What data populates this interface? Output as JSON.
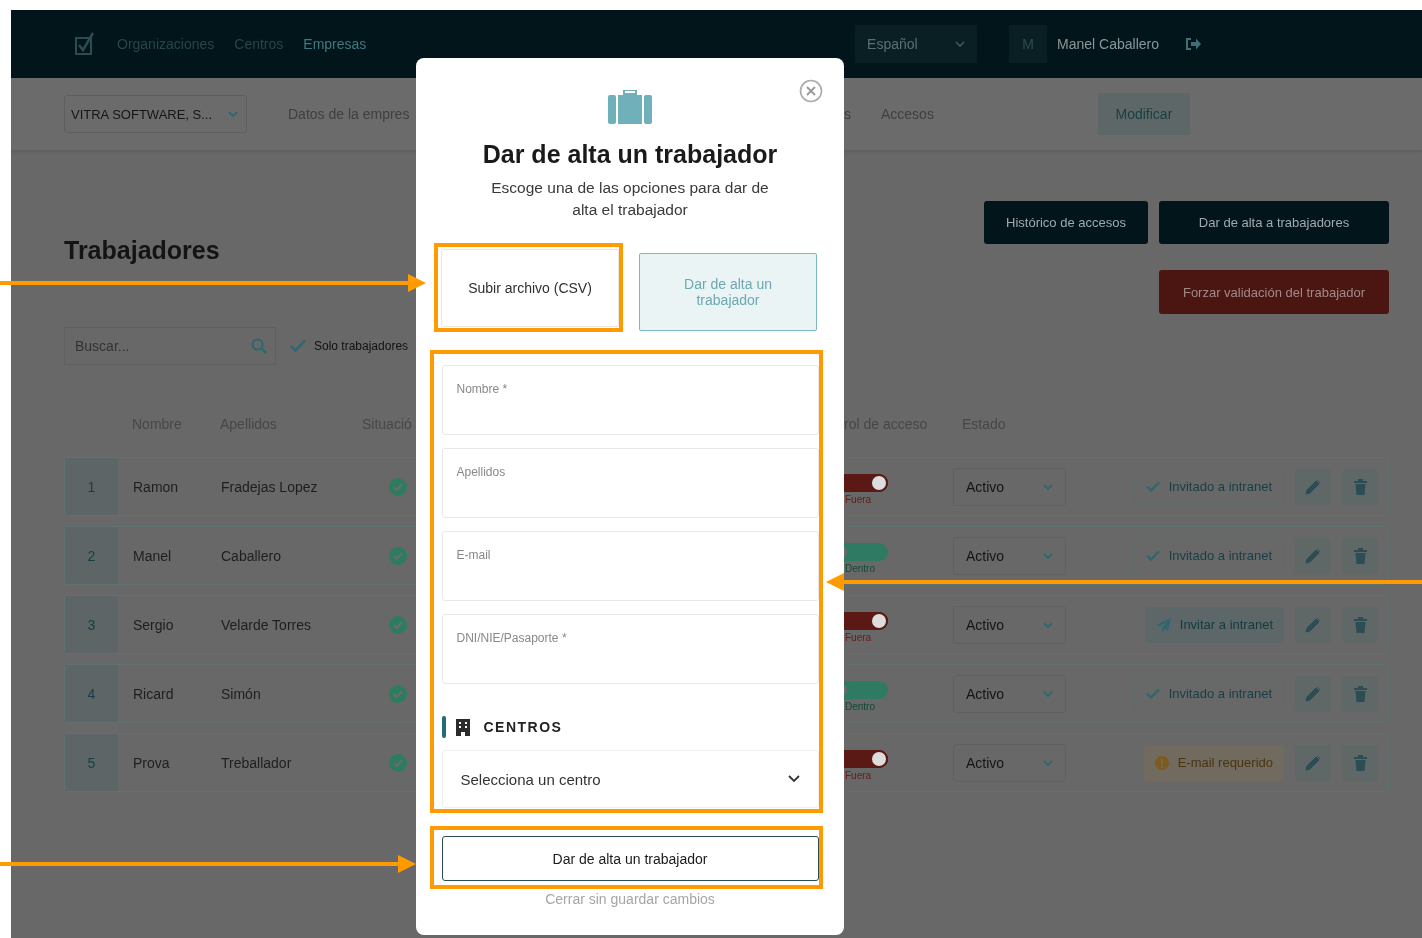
{
  "nav": {
    "links": [
      {
        "label": "Organizaciones",
        "selected": false
      },
      {
        "label": "Centros",
        "selected": false
      },
      {
        "label": "Empresas",
        "selected": true
      }
    ],
    "language": "Español",
    "avatar": "M",
    "user": "Manel Caballero"
  },
  "subheader": {
    "company": "VITRA SOFTWARE, S...",
    "tabs_left": [
      "Datos de la empres"
    ],
    "tabs_right": [
      "s",
      "Accesos"
    ],
    "modify_button": "Modificar"
  },
  "page": {
    "title": "Trabajadores",
    "buttons": [
      "Histórico de accesos",
      "Dar de alta a trabajadores"
    ],
    "force_button": "Forzar validación del trabajador",
    "search": {
      "placeholder": "Buscar..."
    },
    "filter": {
      "label": "Solo trabajadores",
      "checked": true
    }
  },
  "table": {
    "columns_left": [
      "Nombre",
      "Apellidos",
      "Situació"
    ],
    "columns_right": [
      "rol de acceso",
      "Estado"
    ],
    "rows": [
      {
        "number": "1",
        "name": "Ramon",
        "surname": "Fradejas Lopez",
        "verified": true,
        "access_on": false,
        "access_label": "Fuera",
        "status": "Activo",
        "invite": {
          "kind": "invited",
          "label": "Invitado a intranet"
        }
      },
      {
        "number": "2",
        "name": "Manel",
        "surname": "Caballero",
        "verified": true,
        "access_on": true,
        "access_label": "Dentro",
        "status": "Activo",
        "invite": {
          "kind": "invited",
          "label": "Invitado a intranet"
        }
      },
      {
        "number": "3",
        "name": "Sergio",
        "surname": "Velarde Torres",
        "verified": true,
        "access_on": false,
        "access_label": "Fuera",
        "status": "Activo",
        "invite": {
          "kind": "invite",
          "label": "Invitar a intranet"
        }
      },
      {
        "number": "4",
        "name": "Ricard",
        "surname": "Simón",
        "verified": true,
        "access_on": true,
        "access_label": "Dentro",
        "status": "Activo",
        "invite": {
          "kind": "invited",
          "label": "Invitado a intranet"
        }
      },
      {
        "number": "5",
        "name": "Prova",
        "surname": "Treballador",
        "verified": true,
        "access_on": false,
        "access_label": "Fuera",
        "status": "Activo",
        "invite": {
          "kind": "email_required",
          "label": "E-mail requerido"
        }
      }
    ]
  },
  "modal": {
    "title": "Dar de alta un trabajador",
    "subtitle": "Escoge una de las opciones para dar de alta el trabajador",
    "options": [
      {
        "label": "Subir archivo (CSV)",
        "selected": false
      },
      {
        "label": "Dar de alta un trabajador",
        "selected": true
      }
    ],
    "fields": [
      {
        "label": "Nombre *"
      },
      {
        "label": "Apellidos"
      },
      {
        "label": "E-mail"
      },
      {
        "label": "DNI/NIE/Pasaporte *"
      }
    ],
    "section": "CENTROS",
    "center_select": "Selecciona un centro",
    "submit": "Dar de alta un trabajador",
    "cancel": "Cerrar sin guardar cambios"
  }
}
